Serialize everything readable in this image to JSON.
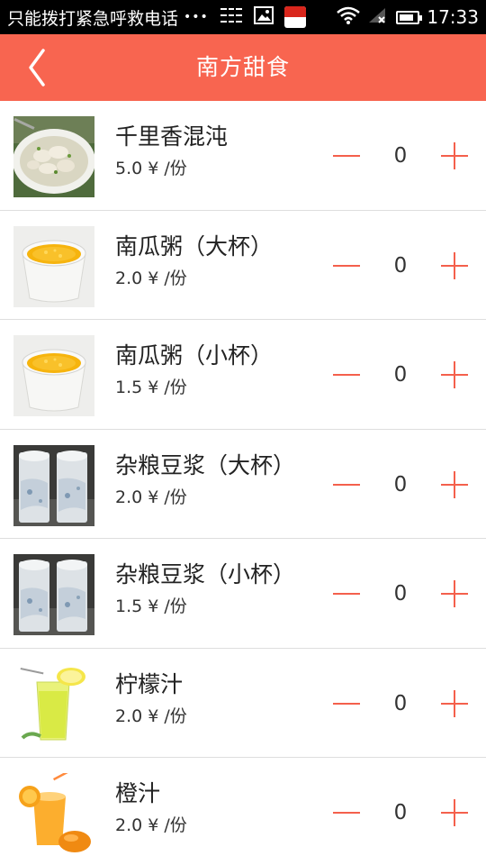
{
  "status_bar": {
    "carrier_text": "只能拨打紧急呼救电话",
    "dots": "•••",
    "time": "17:33",
    "battery_level": 0.85
  },
  "header": {
    "title": "南方甜食"
  },
  "colors": {
    "header_bg": "#f86550",
    "stepper_accent": "#f4604c"
  },
  "items": [
    {
      "name": "千里香混沌",
      "price": "5.0 ¥",
      "unit": "/份",
      "quantity": "0",
      "image": "wonton-soup"
    },
    {
      "name": "南瓜粥（大杯）",
      "price": "2.0 ¥",
      "unit": "/份",
      "quantity": "0",
      "image": "pumpkin-porridge"
    },
    {
      "name": "南瓜粥（小杯）",
      "price": "1.5 ¥",
      "unit": "/份",
      "quantity": "0",
      "image": "pumpkin-porridge"
    },
    {
      "name": "杂粮豆浆（大杯）",
      "price": "2.0 ¥",
      "unit": "/份",
      "quantity": "0",
      "image": "soy-milk"
    },
    {
      "name": "杂粮豆浆（小杯）",
      "price": "1.5 ¥",
      "unit": "/份",
      "quantity": "0",
      "image": "soy-milk"
    },
    {
      "name": "柠檬汁",
      "price": "2.0 ¥",
      "unit": "/份",
      "quantity": "0",
      "image": "lemon-juice"
    },
    {
      "name": "橙汁",
      "price": "2.0 ¥",
      "unit": "/份",
      "quantity": "0",
      "image": "orange-juice"
    }
  ]
}
